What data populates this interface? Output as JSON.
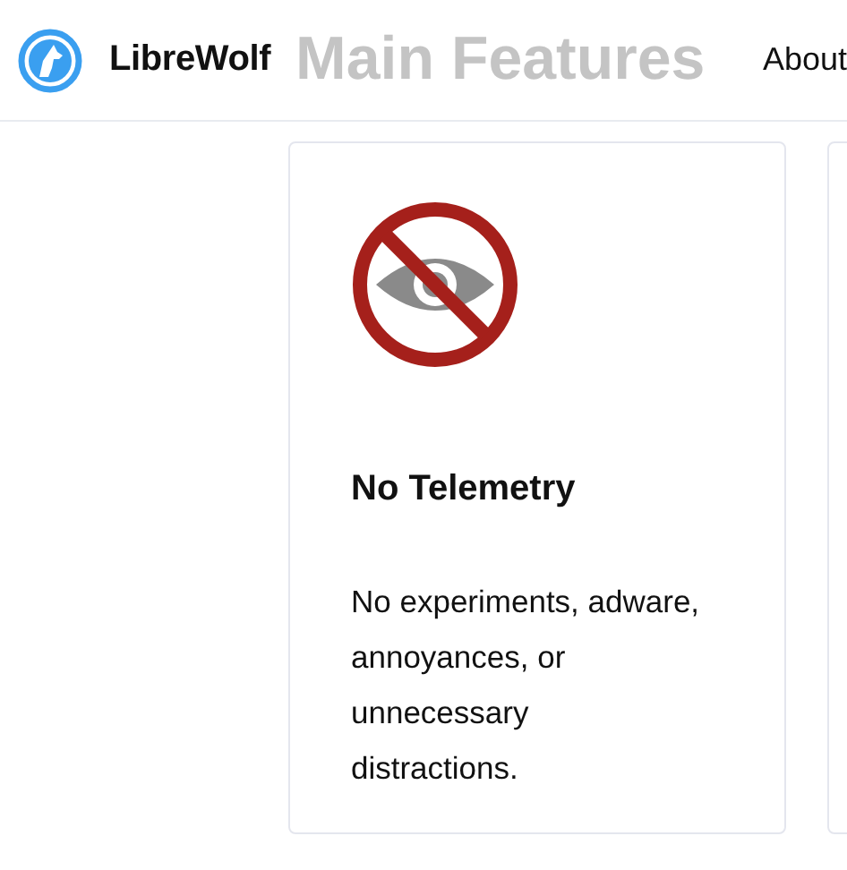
{
  "header": {
    "brand": "LibreWolf",
    "ghost_title": "Main Features",
    "nav": [
      "About"
    ]
  },
  "features": [
    {
      "kind": "full",
      "title": "No Telemetry",
      "text": "No experiments, adware, annoyances, or unnecessary distractions."
    },
    {
      "kind": "cut"
    }
  ]
}
